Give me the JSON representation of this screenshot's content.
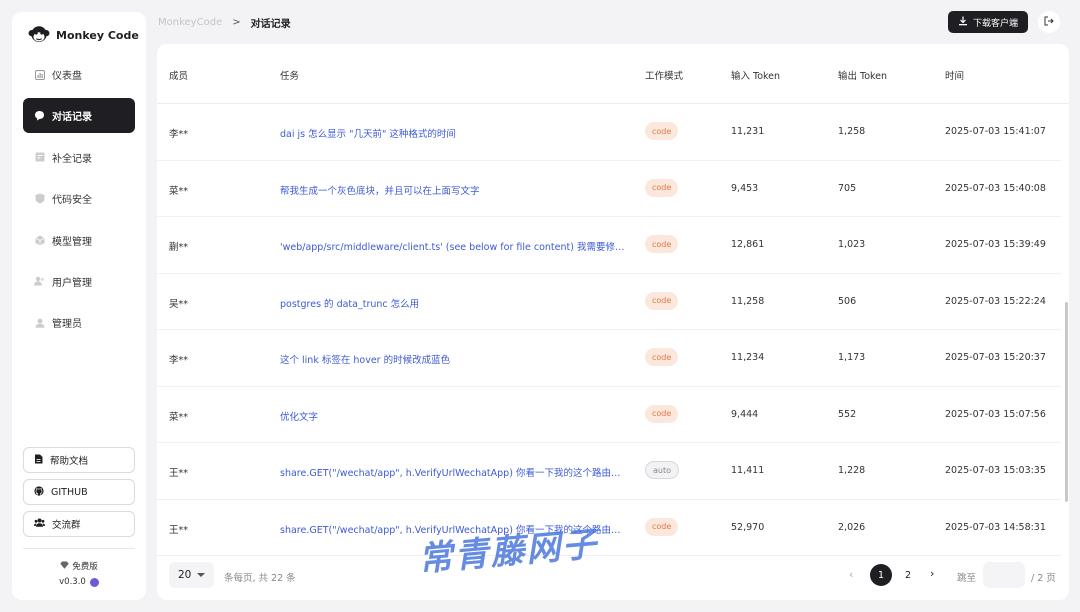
{
  "brand": {
    "name": "Monkey Code"
  },
  "sidebar": {
    "items": [
      {
        "label": "仪表盘",
        "icon": "dashboard-icon"
      },
      {
        "label": "对话记录",
        "icon": "chat-icon",
        "active": true
      },
      {
        "label": "补全记录",
        "icon": "completion-icon"
      },
      {
        "label": "代码安全",
        "icon": "shield-icon"
      },
      {
        "label": "模型管理",
        "icon": "cube-icon"
      },
      {
        "label": "用户管理",
        "icon": "users-icon"
      },
      {
        "label": "管理员",
        "icon": "admin-icon"
      }
    ],
    "buttons": [
      {
        "label": "帮助文档",
        "icon": "doc-icon"
      },
      {
        "label": "GITHUB",
        "icon": "github-icon"
      },
      {
        "label": "交流群",
        "icon": "group-icon"
      }
    ],
    "edition": "免费版",
    "version": "v0.3.0"
  },
  "header": {
    "breadcrumb_root": "MonkeyCode",
    "breadcrumb_sep": ">",
    "breadcrumb_current": "对话记录",
    "download_label": "下载客户端"
  },
  "table": {
    "columns": [
      "成员",
      "任务",
      "工作模式",
      "输入 Token",
      "输出 Token",
      "时间"
    ],
    "rows": [
      {
        "member": "李**",
        "task": "dai js 怎么显示 \"几天前\" 这种格式的时间",
        "mode": "code",
        "input": "11,231",
        "output": "1,258",
        "time": "2025-07-03 15:41:07"
      },
      {
        "member": "菜**",
        "task": "帮我生成一个灰色底块，并且可以在上面写文字",
        "mode": "code",
        "input": "9,453",
        "output": "705",
        "time": "2025-07-03 15:40:08"
      },
      {
        "member": "蒯**",
        "task": "'web/app/src/middleware/client.ts' (see below for file content) 我需要修改这里的逻辑",
        "mode": "code",
        "input": "12,861",
        "output": "1,023",
        "time": "2025-07-03 15:39:49"
      },
      {
        "member": "吴**",
        "task": "postgres 的 data_trunc 怎么用",
        "mode": "code",
        "input": "11,258",
        "output": "506",
        "time": "2025-07-03 15:22:24"
      },
      {
        "member": "李**",
        "task": "这个 link 标签在 hover 的时候改成蓝色",
        "mode": "code",
        "input": "11,234",
        "output": "1,173",
        "time": "2025-07-03 15:20:37"
      },
      {
        "member": "菜**",
        "task": "优化文字",
        "mode": "code",
        "input": "9,444",
        "output": "552",
        "time": "2025-07-03 15:07:56"
      },
      {
        "member": "王**",
        "task": "share.GET(\"/wechat/app\", h.VerifyUrlWechatApp) 你看一下我的这个路由是否正确",
        "mode": "auto",
        "input": "11,411",
        "output": "1,228",
        "time": "2025-07-03 15:03:35"
      },
      {
        "member": "王**",
        "task": "share.GET(\"/wechat/app\", h.VerifyUrlWechatApp) 你看一下我的这个路由是否正确",
        "mode": "code",
        "input": "52,970",
        "output": "2,026",
        "time": "2025-07-03 14:58:31"
      }
    ]
  },
  "pagination": {
    "page_size": "20",
    "summary": "条每页, 共 22 条",
    "pages": [
      "1",
      "2"
    ],
    "current": "1",
    "jump_label": "跳至",
    "total_pages": "/ 2 页"
  },
  "watermark": "常青藤网子"
}
